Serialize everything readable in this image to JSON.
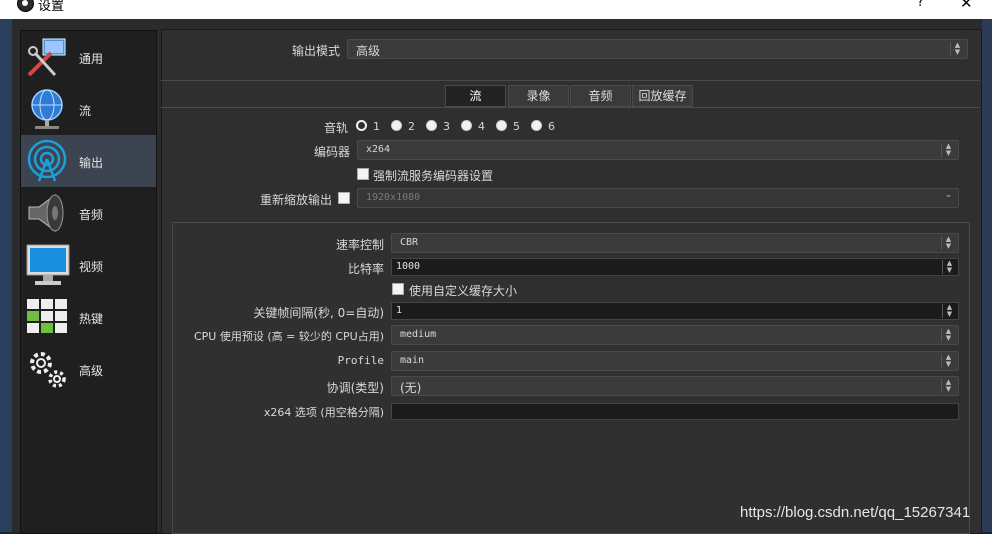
{
  "window": {
    "title": "设置",
    "help": "?",
    "close": "✕"
  },
  "sidebar": {
    "items": [
      {
        "label": "通用",
        "icon": "general-tools-icon"
      },
      {
        "label": "流",
        "icon": "stream-globe-icon"
      },
      {
        "label": "输出",
        "icon": "output-broadcast-icon"
      },
      {
        "label": "音频",
        "icon": "speaker-icon"
      },
      {
        "label": "视频",
        "icon": "monitor-icon"
      },
      {
        "label": "热键",
        "icon": "keyboard-icon"
      },
      {
        "label": "高级",
        "icon": "gears-icon"
      }
    ],
    "active": "输出"
  },
  "output_mode": {
    "label": "输出模式",
    "value": "高级"
  },
  "tabs": [
    {
      "label": "流",
      "active": true
    },
    {
      "label": "录像",
      "active": false
    },
    {
      "label": "音频",
      "active": false
    },
    {
      "label": "回放缓存",
      "active": false
    }
  ],
  "stream": {
    "audio_track": {
      "label": "音轨",
      "options": [
        "1",
        "2",
        "3",
        "4",
        "5",
        "6"
      ],
      "selected": "1"
    },
    "encoder": {
      "label": "编码器",
      "value": "x264"
    },
    "enforce": {
      "label": "强制流服务编码器设置",
      "checked": false
    },
    "rescale": {
      "label": "重新缩放输出",
      "checked": false,
      "value": "1920x1080"
    }
  },
  "encoder_settings": {
    "rate_control": {
      "label": "速率控制",
      "value": "CBR"
    },
    "bitrate": {
      "label": "比特率",
      "value": "1000"
    },
    "custom_buffer": {
      "label": "使用自定义缓存大小",
      "checked": false
    },
    "keyframe": {
      "label": "关键帧间隔(秒, 0=自动)",
      "value": "1"
    },
    "preset": {
      "label": "CPU 使用预设 (高 = 较少的 CPU占用)",
      "value": "medium"
    },
    "profile": {
      "label": "Profile",
      "value": "main"
    },
    "tune": {
      "label": "协调(类型)",
      "value": "(无)"
    },
    "x264opts": {
      "label": "x264 选项 (用空格分隔)",
      "value": ""
    }
  },
  "watermark": "https://blog.csdn.net/qq_15267341",
  "colors": {
    "panel": "#2f2f2f",
    "sidebar_active": "#3c4452",
    "input_bg": "#1b1b1b"
  }
}
